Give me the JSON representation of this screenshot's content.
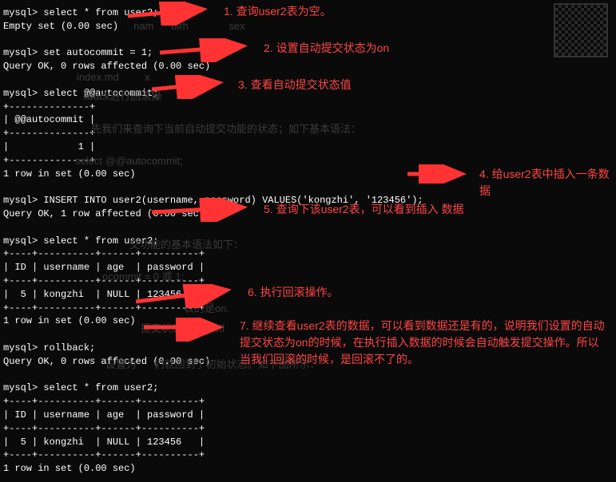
{
  "terminal": {
    "prompt": "mysql>",
    "blocks": [
      {
        "cmd": "select * from user2;",
        "out": "Empty set (0.00 sec)"
      },
      {
        "cmd": "set autocommit = 1;",
        "out": "Query OK, 0 rows affected (0.00 sec)"
      },
      {
        "cmd": "select @@autocommit;",
        "out": "+--------------+\n| @@autocommit |\n+--------------+\n|            1 |\n+--------------+\n1 row in set (0.00 sec)"
      },
      {
        "cmd": "INSERT INTO user2(username, password) VALUES('kongzhi', '123456');",
        "out": "Query OK, 1 row affected (0.00 sec)"
      },
      {
        "cmd": "select * from user2;",
        "out": "+----+----------+------+----------+\n| ID | username | age  | password |\n+----+----------+------+----------+\n|  5 | kongzhi  | NULL | 123456   |\n+----+----------+------+----------+\n1 row in set (0.00 sec)"
      },
      {
        "cmd": "rollback;",
        "out": "Query OK, 0 rows affected (0.00 sec)"
      },
      {
        "cmd": "select * from user2;",
        "out": "+----+----------+------+----------+\n| ID | username | age  | password |\n+----+----------+------+----------+\n|  5 | kongzhi  | NULL | 123456   |\n+----+----------+------+----------+\n1 row in set (0.00 sec)"
      }
    ]
  },
  "annotations": {
    "a1": "1. 查询user2表为空。",
    "a2": "2. 设置自动提交状态为on",
    "a3": "3. 查看自动提交状态值",
    "a4": "4. 给user2表中插入一条数据",
    "a5": "5. 查询下该user2表，可以看到插入 数据",
    "a6": "6. 执行回滚操作。",
    "a7": "7. 继续查看user2表的数据，可以看到数据还是有的，说明我们设置的自动提交状态为on的时候，在执行插入数据的时候会自动触发提交操作。所以当我们回滚的时候，是回滚不了的。"
  },
  "ghost": {
    "g1": "  nam      birh              sex",
    "g2": "index.md         x",
    "g3": "llback进行回滚操",
    "g4": "先我们来查询下当前自动提交功能的状态；如下基本语法：",
    "g5": "select @@autocommit;",
    "g6": "交功能的基本语法如下：",
    "g7": "ocommit = 0 或 1;",
    "g8": "表的是on.",
    "g9": "提交状态设置为off",
    "g10": "设置为      们就回到了初始状态。如下图所示："
  }
}
